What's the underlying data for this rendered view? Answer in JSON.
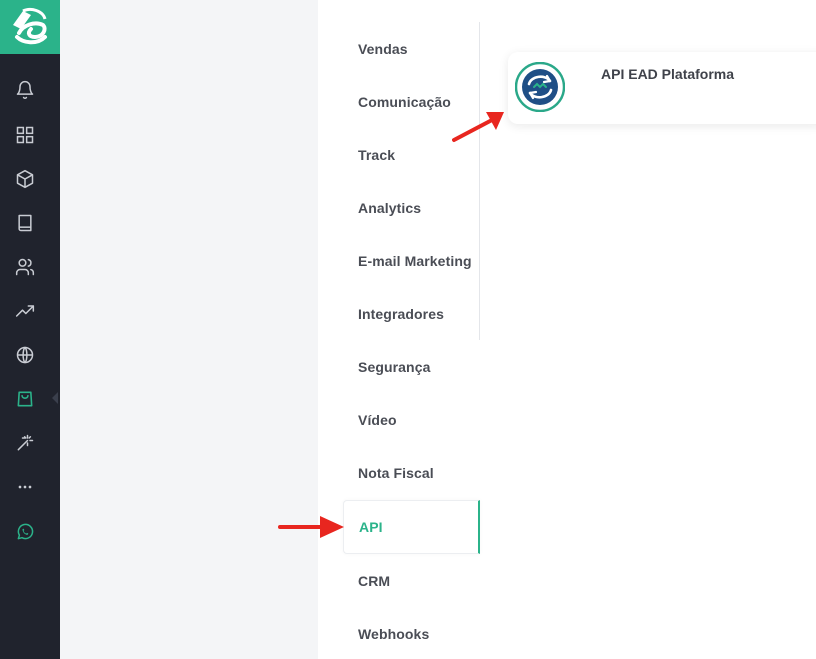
{
  "sidebar": {
    "icons": [
      {
        "name": "bell-icon"
      },
      {
        "name": "dashboard-grid-icon"
      },
      {
        "name": "product-box-icon"
      },
      {
        "name": "book-icon"
      },
      {
        "name": "users-icon"
      },
      {
        "name": "trending-up-icon"
      },
      {
        "name": "globe-icon"
      },
      {
        "name": "shopping-bag-icon"
      },
      {
        "name": "magic-wand-icon"
      },
      {
        "name": "more-icon"
      },
      {
        "name": "whatsapp-icon"
      }
    ],
    "active_index": 7
  },
  "categories": {
    "items": [
      {
        "label": "Vendas"
      },
      {
        "label": "Comunicação"
      },
      {
        "label": "Track"
      },
      {
        "label": "Analytics"
      },
      {
        "label": "E-mail Marketing"
      },
      {
        "label": "Integradores"
      },
      {
        "label": "Segurança"
      },
      {
        "label": "Vídeo"
      },
      {
        "label": "Nota Fiscal"
      },
      {
        "label": "API"
      },
      {
        "label": "CRM"
      },
      {
        "label": "Webhooks"
      }
    ],
    "active": "API"
  },
  "integration_card": {
    "title": "API EAD Plataforma",
    "icon": "api-ead-logo-icon"
  },
  "colors": {
    "accent": "#2bb38a",
    "sidebar_bg": "#20232d",
    "annotation_arrow": "#e8261f"
  }
}
